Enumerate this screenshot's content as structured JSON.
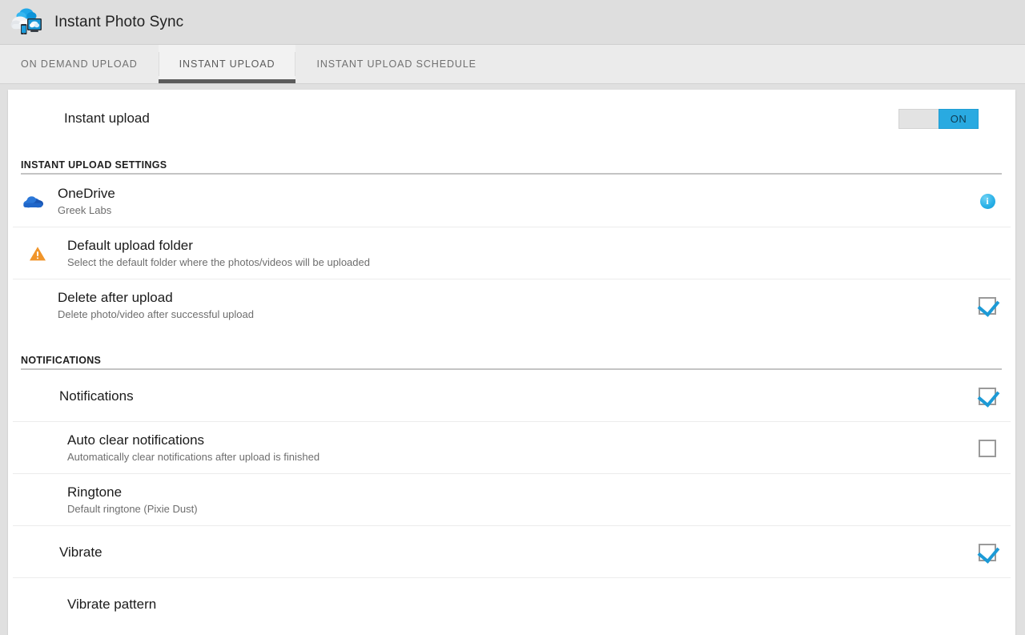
{
  "app": {
    "title": "Instant Photo Sync",
    "icon": "cloud-devices-icon"
  },
  "tabs": [
    {
      "label": "ON DEMAND UPLOAD",
      "active": false
    },
    {
      "label": "INSTANT UPLOAD",
      "active": true
    },
    {
      "label": "INSTANT UPLOAD SCHEDULE",
      "active": false
    }
  ],
  "colors": {
    "accent": "#29aae1",
    "warning": "#f0952b",
    "tab_underline": "#5b5b5b",
    "onedrive_blue": "#1b5fbe"
  },
  "master": {
    "title": "Instant upload",
    "switch_state": "ON"
  },
  "sections": [
    {
      "label": "INSTANT UPLOAD SETTINGS",
      "rows": [
        {
          "title": "OneDrive",
          "subtitle": "Greek Labs",
          "icon": "onedrive-cloud-icon",
          "accessory": "info-icon"
        },
        {
          "title": "Default upload folder",
          "subtitle": "Select the default folder where the photos/videos will be uploaded",
          "icon": "warning-triangle-icon",
          "accessory": "none"
        },
        {
          "title": "Delete after upload",
          "subtitle": "Delete photo/video after successful upload",
          "icon": "none",
          "accessory": "checkbox-checked"
        }
      ]
    },
    {
      "label": "NOTIFICATIONS",
      "rows": [
        {
          "title": "Notifications",
          "subtitle": "",
          "icon": "none",
          "accessory": "checkbox-checked"
        },
        {
          "title": "Auto clear notifications",
          "subtitle": "Automatically clear notifications after upload is finished",
          "icon": "none",
          "accessory": "checkbox-unchecked"
        },
        {
          "title": "Ringtone",
          "subtitle": "Default ringtone (Pixie Dust)",
          "icon": "none",
          "accessory": "none"
        },
        {
          "title": "Vibrate",
          "subtitle": "",
          "icon": "none",
          "accessory": "checkbox-checked"
        },
        {
          "title": "Vibrate pattern",
          "subtitle": "",
          "icon": "none",
          "accessory": "none"
        }
      ]
    }
  ]
}
